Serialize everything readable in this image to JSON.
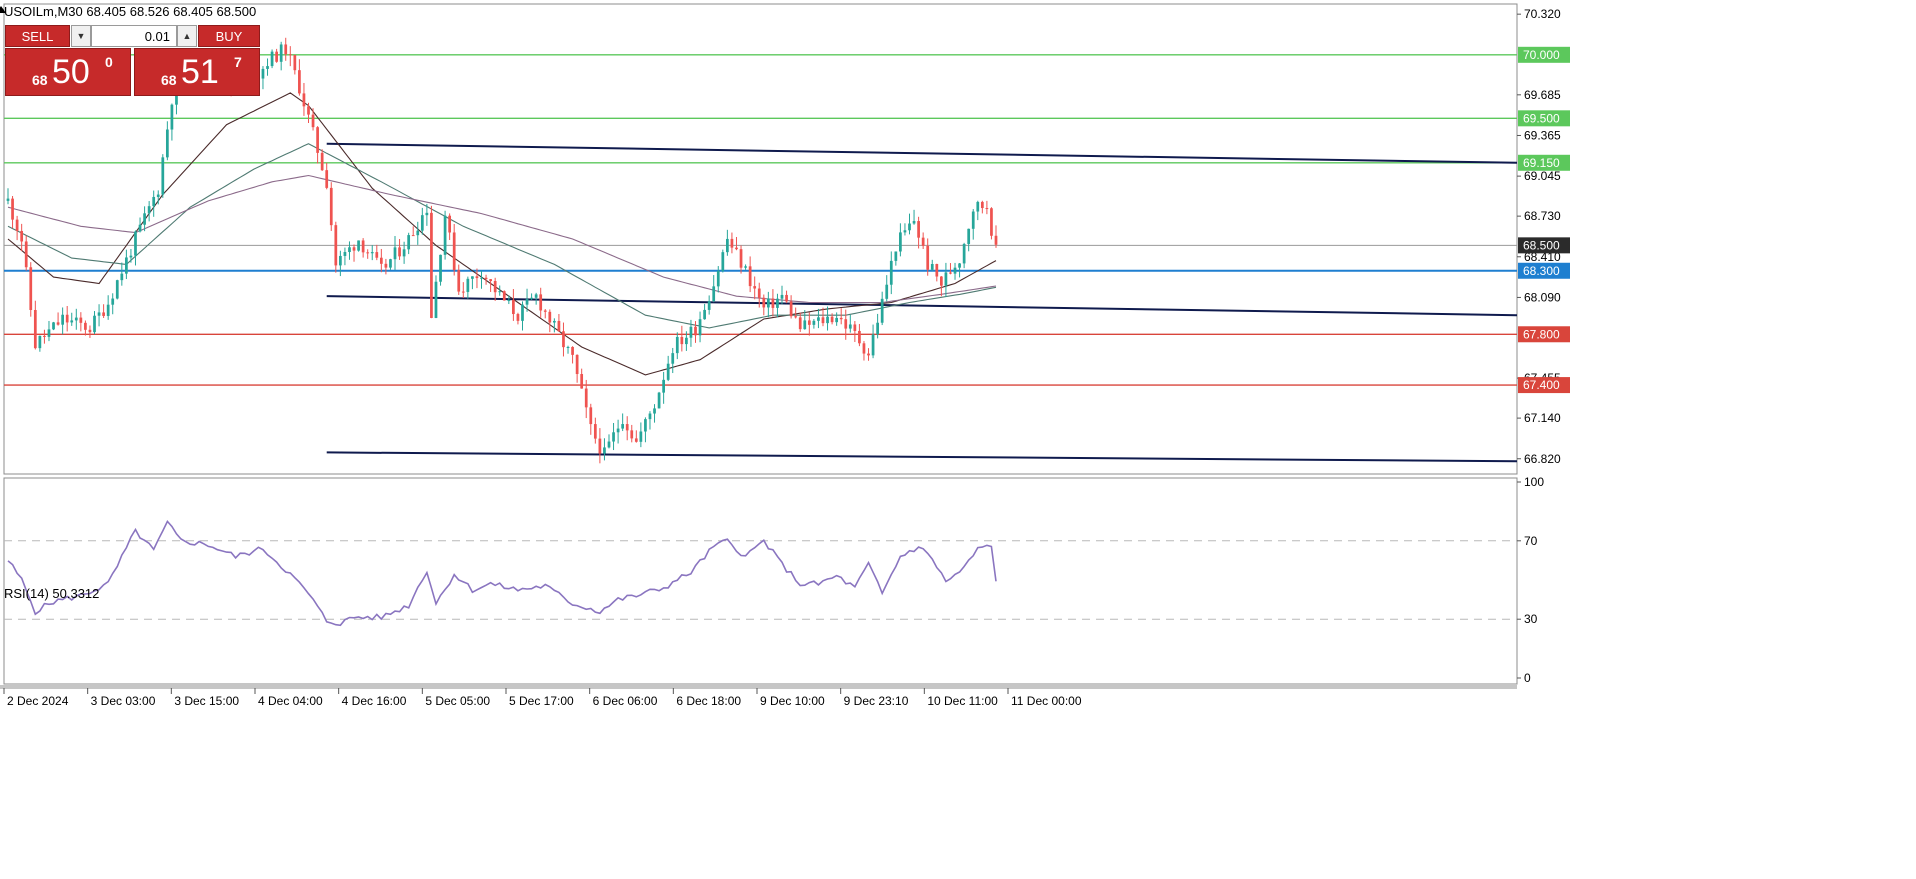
{
  "symbol_line": "USOILm,M30  68.405 68.526 68.405 68.500",
  "trade_panel": {
    "sell_label": "SELL",
    "buy_label": "BUY",
    "lot_value": "0.01",
    "sell_price": {
      "small": "68",
      "big": "50",
      "sup": "0"
    },
    "buy_price": {
      "small": "68",
      "big": "51",
      "sup": "7"
    }
  },
  "colors": {
    "bull": "#26a69a",
    "bear": "#ef5350",
    "resistance": "#5cc85c",
    "support": "#d9453b",
    "pivot": "#1e7fd0",
    "channel": "#0f1a4d",
    "rsi": "#8a75c0",
    "current_price": "#2b2b2b"
  },
  "chart_data": [
    {
      "type": "candlestick",
      "symbol": "USOILm",
      "timeframe": "M30",
      "ylim": [
        66.7,
        70.4
      ],
      "price_ticks": [
        "70.320",
        "69.685",
        "69.365",
        "69.045",
        "68.730",
        "68.410",
        "68.090",
        "67.455",
        "67.140",
        "66.820"
      ],
      "time_ticks": [
        "2 Dec 2024",
        "3 Dec 03:00",
        "3 Dec 15:00",
        "4 Dec 04:00",
        "4 Dec 16:00",
        "5 Dec 05:00",
        "5 Dec 17:00",
        "6 Dec 06:00",
        "6 Dec 18:00",
        "9 Dec 10:00",
        "9 Dec 23:10",
        "10 Dec 11:00",
        "11 Dec 00:00"
      ],
      "price_anchors": [
        [
          0,
          68.85
        ],
        [
          3,
          68.55
        ],
        [
          6,
          67.72
        ],
        [
          12,
          67.92
        ],
        [
          18,
          67.85
        ],
        [
          22,
          68.05
        ],
        [
          28,
          68.55
        ],
        [
          33,
          68.95
        ],
        [
          37,
          69.9
        ],
        [
          42,
          69.85
        ],
        [
          48,
          69.8
        ],
        [
          53,
          69.75
        ],
        [
          57,
          69.95
        ],
        [
          61,
          70.05
        ],
        [
          64,
          69.75
        ],
        [
          70,
          69.0
        ],
        [
          72,
          68.35
        ],
        [
          77,
          68.55
        ],
        [
          82,
          68.3
        ],
        [
          88,
          68.55
        ],
        [
          92,
          68.8
        ],
        [
          93,
          67.95
        ],
        [
          96,
          68.75
        ],
        [
          99,
          68.15
        ],
        [
          104,
          68.3
        ],
        [
          108,
          68.1
        ],
        [
          112,
          67.95
        ],
        [
          116,
          68.1
        ],
        [
          120,
          67.85
        ],
        [
          124,
          67.6
        ],
        [
          128,
          67.05
        ],
        [
          131,
          66.85
        ],
        [
          135,
          67.15
        ],
        [
          138,
          66.95
        ],
        [
          142,
          67.25
        ],
        [
          146,
          67.7
        ],
        [
          151,
          67.85
        ],
        [
          155,
          68.2
        ],
        [
          158,
          68.55
        ],
        [
          162,
          68.3
        ],
        [
          166,
          68.0
        ],
        [
          170,
          68.1
        ],
        [
          174,
          67.85
        ],
        [
          178,
          67.9
        ],
        [
          182,
          67.95
        ],
        [
          186,
          67.8
        ],
        [
          189,
          67.65
        ],
        [
          192,
          68.05
        ],
        [
          195,
          68.5
        ],
        [
          199,
          68.7
        ],
        [
          202,
          68.35
        ],
        [
          205,
          68.2
        ],
        [
          209,
          68.4
        ],
        [
          212,
          68.8
        ],
        [
          215,
          68.82
        ],
        [
          217,
          68.45
        ]
      ],
      "moving_averages": [
        {
          "color": "#4a2a2a",
          "points": [
            [
              0,
              68.55
            ],
            [
              10,
              68.25
            ],
            [
              20,
              68.2
            ],
            [
              34,
              68.9
            ],
            [
              48,
              69.45
            ],
            [
              62,
              69.7
            ],
            [
              66,
              69.6
            ],
            [
              80,
              68.95
            ],
            [
              94,
              68.5
            ],
            [
              112,
              68.05
            ],
            [
              126,
              67.7
            ],
            [
              140,
              67.48
            ],
            [
              152,
              67.6
            ],
            [
              166,
              67.92
            ],
            [
              180,
              68.0
            ],
            [
              194,
              68.05
            ],
            [
              208,
              68.2
            ],
            [
              217,
              68.38
            ]
          ]
        },
        {
          "color": "#4f7a72",
          "points": [
            [
              0,
              68.65
            ],
            [
              14,
              68.4
            ],
            [
              26,
              68.35
            ],
            [
              40,
              68.8
            ],
            [
              54,
              69.1
            ],
            [
              66,
              69.3
            ],
            [
              82,
              69.0
            ],
            [
              100,
              68.65
            ],
            [
              120,
              68.35
            ],
            [
              140,
              67.95
            ],
            [
              154,
              67.85
            ],
            [
              168,
              67.95
            ],
            [
              184,
              67.95
            ],
            [
              198,
              68.05
            ],
            [
              210,
              68.12
            ],
            [
              217,
              68.17
            ]
          ]
        },
        {
          "color": "#8b6a8a",
          "points": [
            [
              0,
              68.8
            ],
            [
              16,
              68.65
            ],
            [
              28,
              68.6
            ],
            [
              44,
              68.85
            ],
            [
              58,
              69.0
            ],
            [
              66,
              69.05
            ],
            [
              84,
              68.9
            ],
            [
              104,
              68.75
            ],
            [
              124,
              68.55
            ],
            [
              144,
              68.25
            ],
            [
              160,
              68.1
            ],
            [
              176,
              68.05
            ],
            [
              192,
              68.05
            ],
            [
              206,
              68.12
            ],
            [
              217,
              68.18
            ]
          ]
        }
      ],
      "horizontal_levels": [
        {
          "price": 70.0,
          "label": "70.000",
          "role": "resistance"
        },
        {
          "price": 69.5,
          "label": "69.500",
          "role": "resistance"
        },
        {
          "price": 69.15,
          "label": "69.150",
          "role": "resistance"
        },
        {
          "price": 68.3,
          "label": "68.300",
          "role": "pivot"
        },
        {
          "price": 67.8,
          "label": "67.800",
          "role": "support"
        },
        {
          "price": 67.4,
          "label": "67.400",
          "role": "support"
        }
      ],
      "current_price": {
        "price": 68.5,
        "label": "68.500"
      },
      "channel_lines": [
        {
          "from": [
            70,
            69.3
          ],
          "to": [
            327,
            69.15
          ]
        },
        {
          "from": [
            70,
            68.1
          ],
          "to": [
            327,
            67.95
          ]
        },
        {
          "from": [
            70,
            66.87
          ],
          "to": [
            327,
            66.8
          ]
        }
      ]
    },
    {
      "type": "line",
      "indicator": "RSI(14)",
      "value_text": "50.3312",
      "label": "RSI(14) 50.3312",
      "ylim": [
        0,
        100
      ],
      "y_ticks": [
        "100",
        "70",
        "30",
        "0"
      ],
      "levels": [
        70,
        30
      ],
      "anchors": [
        [
          0,
          60
        ],
        [
          3,
          50
        ],
        [
          6,
          34
        ],
        [
          10,
          39
        ],
        [
          16,
          42
        ],
        [
          22,
          48
        ],
        [
          28,
          75
        ],
        [
          32,
          65
        ],
        [
          35,
          79
        ],
        [
          38,
          70
        ],
        [
          44,
          68
        ],
        [
          50,
          62
        ],
        [
          56,
          66
        ],
        [
          62,
          53
        ],
        [
          66,
          43
        ],
        [
          70,
          29
        ],
        [
          73,
          28
        ],
        [
          76,
          31
        ],
        [
          82,
          31
        ],
        [
          88,
          37
        ],
        [
          92,
          55
        ],
        [
          94,
          38
        ],
        [
          98,
          53
        ],
        [
          102,
          45
        ],
        [
          106,
          48
        ],
        [
          112,
          45
        ],
        [
          118,
          47
        ],
        [
          124,
          38
        ],
        [
          130,
          34
        ],
        [
          134,
          40
        ],
        [
          138,
          42
        ],
        [
          144,
          46
        ],
        [
          150,
          54
        ],
        [
          155,
          67
        ],
        [
          158,
          70
        ],
        [
          162,
          62
        ],
        [
          166,
          70
        ],
        [
          170,
          58
        ],
        [
          174,
          48
        ],
        [
          178,
          48
        ],
        [
          182,
          52
        ],
        [
          186,
          46
        ],
        [
          189,
          58
        ],
        [
          192,
          43
        ],
        [
          196,
          62
        ],
        [
          200,
          67
        ],
        [
          203,
          61
        ],
        [
          206,
          49
        ],
        [
          210,
          56
        ],
        [
          213,
          66
        ],
        [
          216,
          67
        ],
        [
          217,
          49
        ]
      ]
    }
  ]
}
